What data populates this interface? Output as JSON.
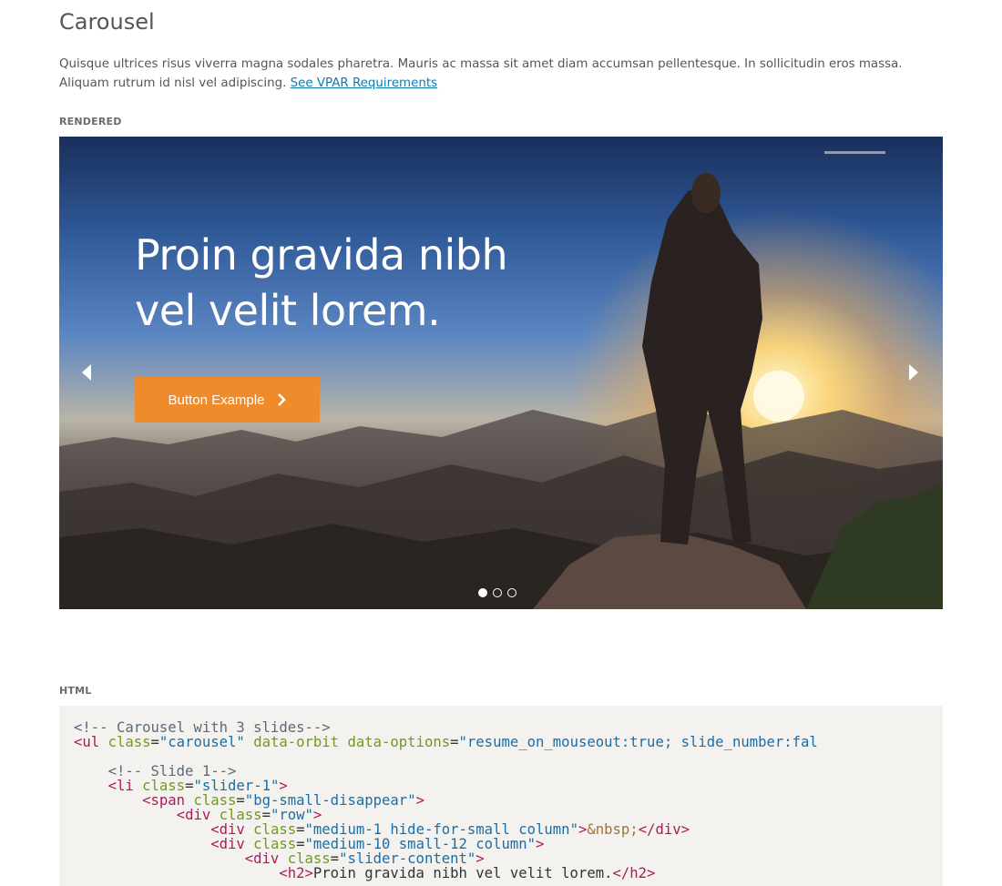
{
  "page": {
    "title": "Carousel",
    "description": "Quisque ultrices risus viverra magna sodales pharetra. Mauris ac massa sit amet diam accumsan pellentesque. In sollicitudin eros massa. Aliquam rutrum id nisl vel adipiscing.",
    "link_text": "See VPAR Requirements"
  },
  "rendered_label": "RENDERED",
  "html_label": "HTML",
  "carousel": {
    "slide_title_line1": "Proin gravida nibh",
    "slide_title_line2": "vel velit lorem.",
    "button_label": "Button Example",
    "slides_count": 3,
    "active_slide": 1,
    "icons": {
      "prev": "chevron-left-icon",
      "next": "chevron-right-icon",
      "button": "chevron-right-icon"
    },
    "colors": {
      "button": "#f08b2c",
      "link": "#0e7ab0"
    }
  },
  "code": {
    "l1_comment": "<!-- Carousel with 3 slides-->",
    "l2_tag": "ul",
    "l2_class": "carousel",
    "l2_data_attr": "data-orbit data-options",
    "l2_data_val": "resume_on_mouseout:true; slide_number:fal",
    "l4_comment": "<!-- Slide 1-->",
    "l5_tag": "li",
    "l5_class": "slider-1",
    "l6_tag": "span",
    "l6_class": "bg-small-disappear",
    "l7_tag": "div",
    "l7_class": "row",
    "l8_class": "medium-1 hide-for-small column",
    "l8_entity": "&nbsp;",
    "l9_class": "medium-10 small-12 column",
    "l10_class": "slider-content",
    "l11_tag": "h2",
    "l11_text": "Proin gravida nibh vel velit lorem."
  }
}
